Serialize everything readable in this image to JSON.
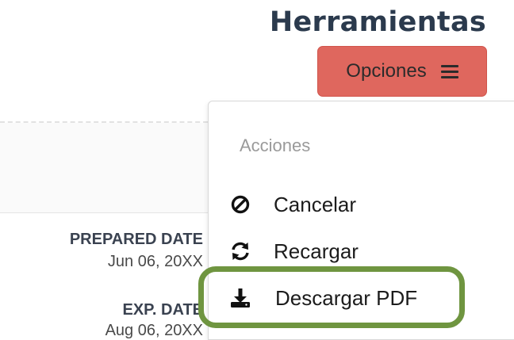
{
  "page": {
    "title": "Herramientas"
  },
  "options_button": {
    "label": "Opciones",
    "icon": "menu-icon",
    "color": "#df675e"
  },
  "document": {
    "prepared_date_label": "PREPARED DATE",
    "prepared_date_value": "Jun 06, 20XX",
    "exp_date_label": "EXP. DATE",
    "exp_date_value": "Aug 06, 20XX"
  },
  "dropdown": {
    "header": "Acciones",
    "items": [
      {
        "label": "Cancelar",
        "icon": "ban-icon"
      },
      {
        "label": "Recargar",
        "icon": "sync-icon"
      },
      {
        "label": "Descargar PDF",
        "icon": "download-icon",
        "highlighted": true
      }
    ]
  },
  "colors": {
    "title": "#2b3a4d",
    "highlight": "#6f9540"
  }
}
